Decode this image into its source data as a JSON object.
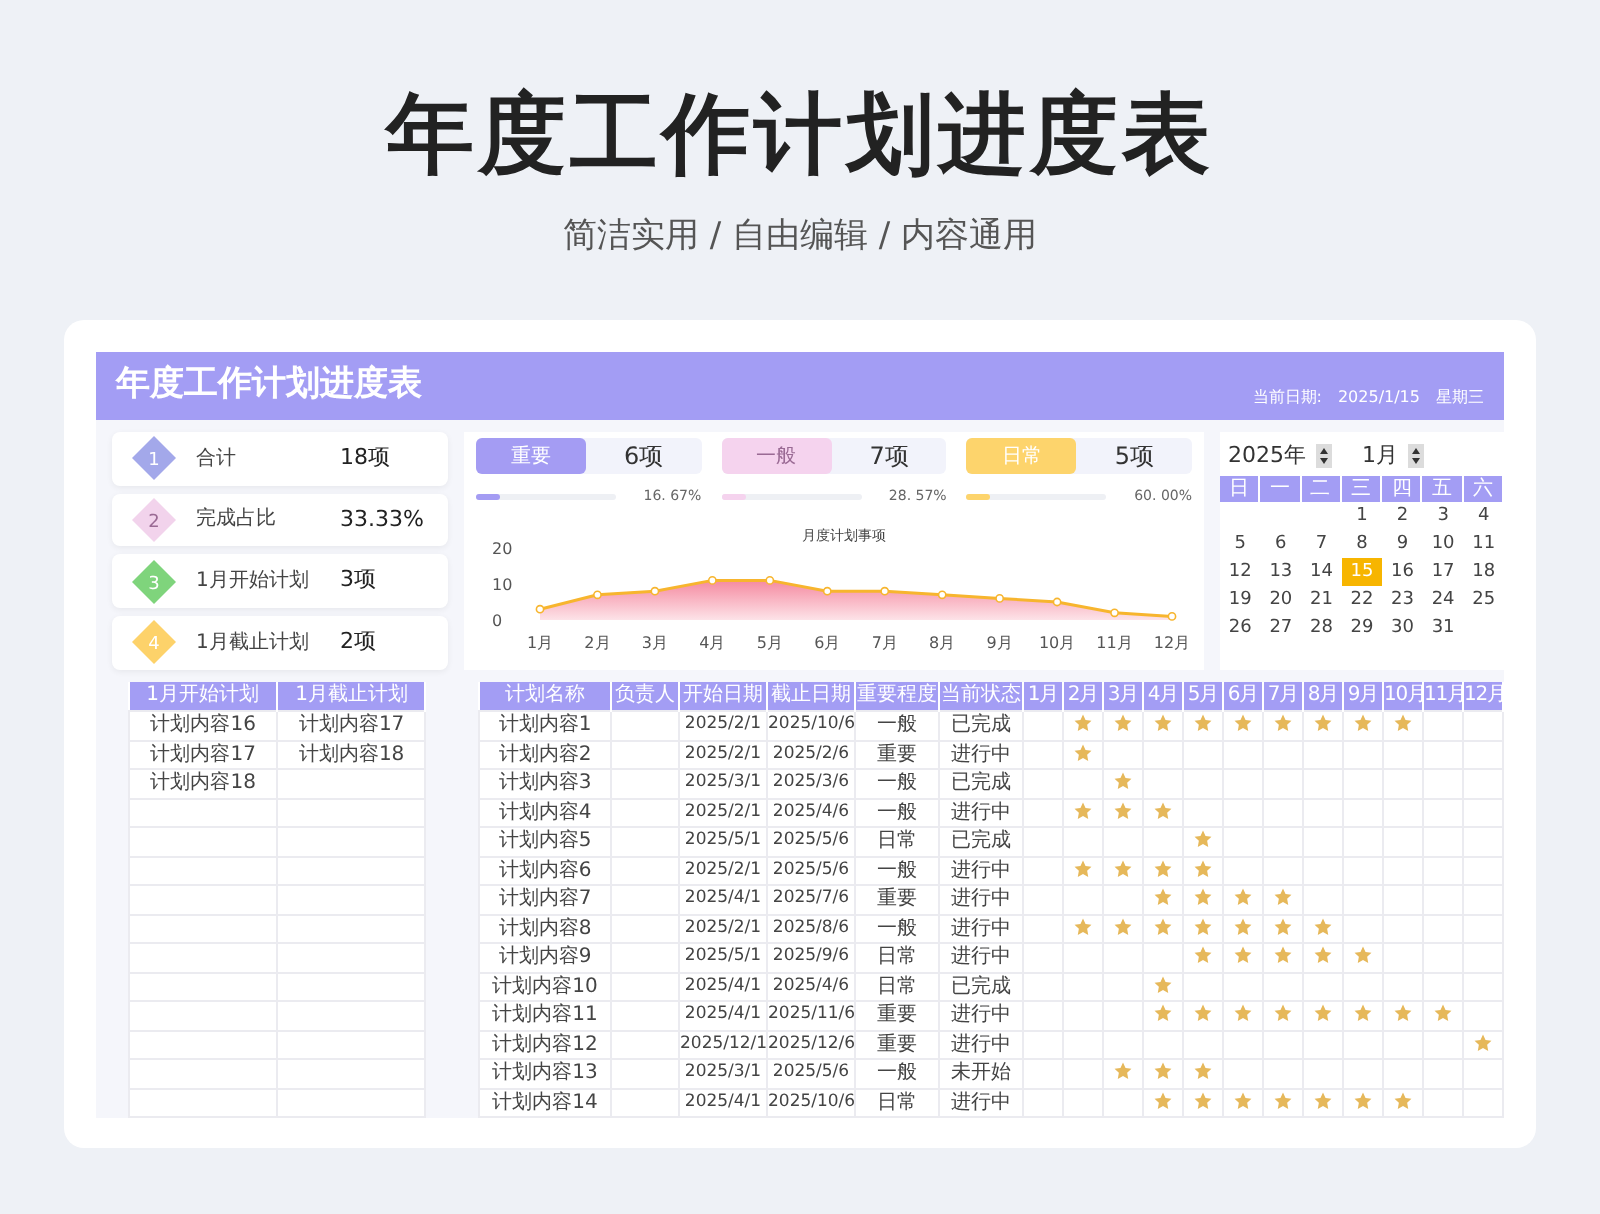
{
  "page_title": "年度工作计划进度表",
  "subtitle": "简洁实用 / 自由编辑 / 内容通用",
  "sheet": {
    "title": "年度工作计划进度表",
    "date_label": "当前日期:",
    "date": "2025/1/15",
    "weekday": "星期三"
  },
  "stats": [
    {
      "number": "1",
      "label": "合计",
      "value": "18项",
      "color": "#a3a8ea"
    },
    {
      "number": "2",
      "label": "完成占比",
      "value": "33.33%",
      "color": "#f2d3ec"
    },
    {
      "number": "3",
      "label": "1月开始计划",
      "value": "3项",
      "color": "#7fd47c"
    },
    {
      "number": "4",
      "label": "1月截止计划",
      "value": "2项",
      "color": "#fdd26a"
    }
  ],
  "categories": [
    {
      "label": "重要",
      "count": "6项",
      "color": "#a49cf3",
      "level": 0.17,
      "percent": "16. 67%"
    },
    {
      "label": "一般",
      "count": "7项",
      "color": "#f5d3ee",
      "level": 0.17,
      "percent": "28. 57%"
    },
    {
      "label": "日常",
      "count": "5项",
      "color": "#fdd46c",
      "level": 0.17,
      "percent": "60. 00%"
    }
  ],
  "chart_data": {
    "type": "area",
    "title": "月度计划事项",
    "categories": [
      "1月",
      "2月",
      "3月",
      "4月",
      "5月",
      "6月",
      "7月",
      "8月",
      "9月",
      "10月",
      "11月",
      "12月"
    ],
    "series": [
      {
        "color": "#f7b52e",
        "values": [
          3,
          7,
          8,
          11,
          11,
          8,
          8,
          7,
          6,
          5,
          2,
          1
        ]
      }
    ],
    "ylim": [
      0,
      20
    ],
    "yticks": [
      0,
      10,
      20
    ]
  },
  "calendar": {
    "year": "2025年",
    "month": "1月",
    "weekdays": [
      "日",
      "一",
      "二",
      "三",
      "四",
      "五",
      "六"
    ],
    "weeks": [
      [
        {
          "day": "1",
          "selected": false
        },
        {
          "day": "2",
          "selected": false
        },
        {
          "day": "3",
          "selected": false
        },
        {
          "day": "4",
          "selected": false
        }
      ],
      [
        {
          "day": "5",
          "selected": false
        },
        {
          "day": "6",
          "selected": false
        },
        {
          "day": "7",
          "selected": false
        },
        {
          "day": "8",
          "selected": false
        },
        {
          "day": "9",
          "selected": false
        },
        {
          "day": "10",
          "selected": false
        },
        {
          "day": "11",
          "selected": false
        }
      ],
      [
        {
          "day": "12",
          "selected": false
        },
        {
          "day": "13",
          "selected": false
        },
        {
          "day": "14",
          "selected": false
        },
        {
          "day": "15",
          "selected": true
        },
        {
          "day": "16",
          "selected": false
        },
        {
          "day": "17",
          "selected": false
        },
        {
          "day": "18",
          "selected": false
        }
      ],
      [
        {
          "day": "19",
          "selected": false
        },
        {
          "day": "20",
          "selected": false
        },
        {
          "day": "21",
          "selected": false
        },
        {
          "day": "22",
          "selected": false
        },
        {
          "day": "23",
          "selected": false
        },
        {
          "day": "24",
          "selected": false
        },
        {
          "day": "25",
          "selected": false
        }
      ],
      [
        {
          "day": "26",
          "selected": false
        },
        {
          "day": "27",
          "selected": false
        },
        {
          "day": "28",
          "selected": false
        },
        {
          "day": "29",
          "selected": false
        },
        {
          "day": "30",
          "selected": false
        },
        {
          "day": "31",
          "selected": false
        }
      ]
    ]
  },
  "month_table": {
    "columns": [
      "1月开始计划",
      "1月截止计划"
    ],
    "rows": [
      [
        "计划内容16",
        "计划内容17"
      ],
      [
        "计划内容17",
        "计划内容18"
      ],
      [
        "计划内容18"
      ]
    ]
  },
  "plan_table": {
    "columns": [
      "计划名称",
      "负责人",
      "开始日期",
      "截止日期",
      "重要程度",
      "当前状态"
    ],
    "month_columns": [
      "1月",
      "2月",
      "3月",
      "4月",
      "5月",
      "6月",
      "7月",
      "8月",
      "9月",
      "10月",
      "11月",
      "12月"
    ],
    "rows": [
      {
        "name": "计划内容1",
        "start": "2025/2/1",
        "end": "2025/10/6",
        "importance": "一般",
        "status": "已完成",
        "months": [
          false,
          true,
          true,
          true,
          true,
          true,
          true,
          true,
          true,
          true,
          false,
          false
        ]
      },
      {
        "name": "计划内容2",
        "start": "2025/2/1",
        "end": "2025/2/6",
        "importance": "重要",
        "status": "进行中",
        "months": [
          false,
          true,
          false,
          false,
          false,
          false,
          false,
          false,
          false,
          false,
          false,
          false
        ]
      },
      {
        "name": "计划内容3",
        "start": "2025/3/1",
        "end": "2025/3/6",
        "importance": "一般",
        "status": "已完成",
        "months": [
          false,
          false,
          true,
          false,
          false,
          false,
          false,
          false,
          false,
          false,
          false,
          false
        ]
      },
      {
        "name": "计划内容4",
        "start": "2025/2/1",
        "end": "2025/4/6",
        "importance": "一般",
        "status": "进行中",
        "months": [
          false,
          true,
          true,
          true,
          false,
          false,
          false,
          false,
          false,
          false,
          false,
          false
        ]
      },
      {
        "name": "计划内容5",
        "start": "2025/5/1",
        "end": "2025/5/6",
        "importance": "日常",
        "status": "已完成",
        "months": [
          false,
          false,
          false,
          false,
          true,
          false,
          false,
          false,
          false,
          false,
          false,
          false
        ]
      },
      {
        "name": "计划内容6",
        "start": "2025/2/1",
        "end": "2025/5/6",
        "importance": "一般",
        "status": "进行中",
        "months": [
          false,
          true,
          true,
          true,
          true,
          false,
          false,
          false,
          false,
          false,
          false,
          false
        ]
      },
      {
        "name": "计划内容7",
        "start": "2025/4/1",
        "end": "2025/7/6",
        "importance": "重要",
        "status": "进行中",
        "months": [
          false,
          false,
          false,
          true,
          true,
          true,
          true,
          false,
          false,
          false,
          false,
          false
        ]
      },
      {
        "name": "计划内容8",
        "start": "2025/2/1",
        "end": "2025/8/6",
        "importance": "一般",
        "status": "进行中",
        "months": [
          false,
          true,
          true,
          true,
          true,
          true,
          true,
          true,
          false,
          false,
          false,
          false
        ]
      },
      {
        "name": "计划内容9",
        "start": "2025/5/1",
        "end": "2025/9/6",
        "importance": "日常",
        "status": "进行中",
        "months": [
          false,
          false,
          false,
          false,
          true,
          true,
          true,
          true,
          true,
          false,
          false,
          false
        ]
      },
      {
        "name": "计划内容10",
        "start": "2025/4/1",
        "end": "2025/4/6",
        "importance": "日常",
        "status": "已完成",
        "months": [
          false,
          false,
          false,
          true,
          false,
          false,
          false,
          false,
          false,
          false,
          false,
          false
        ]
      },
      {
        "name": "计划内容11",
        "start": "2025/4/1",
        "end": "2025/11/6",
        "importance": "重要",
        "status": "进行中",
        "months": [
          false,
          false,
          false,
          true,
          true,
          true,
          true,
          true,
          true,
          true,
          true,
          false
        ]
      },
      {
        "name": "计划内容12",
        "start": "2025/12/1",
        "end": "2025/12/6",
        "importance": "重要",
        "status": "进行中",
        "months": [
          false,
          false,
          false,
          false,
          false,
          false,
          false,
          false,
          false,
          false,
          false,
          true
        ]
      },
      {
        "name": "计划内容13",
        "start": "2025/3/1",
        "end": "2025/5/6",
        "importance": "一般",
        "status": "未开始",
        "months": [
          false,
          false,
          true,
          true,
          true,
          false,
          false,
          false,
          false,
          false,
          false,
          false
        ]
      },
      {
        "name": "计划内容14",
        "start": "2025/4/1",
        "end": "2025/10/6",
        "importance": "日常",
        "status": "进行中",
        "months": [
          false,
          false,
          false,
          true,
          true,
          true,
          true,
          true,
          true,
          true,
          false,
          false
        ]
      }
    ]
  }
}
